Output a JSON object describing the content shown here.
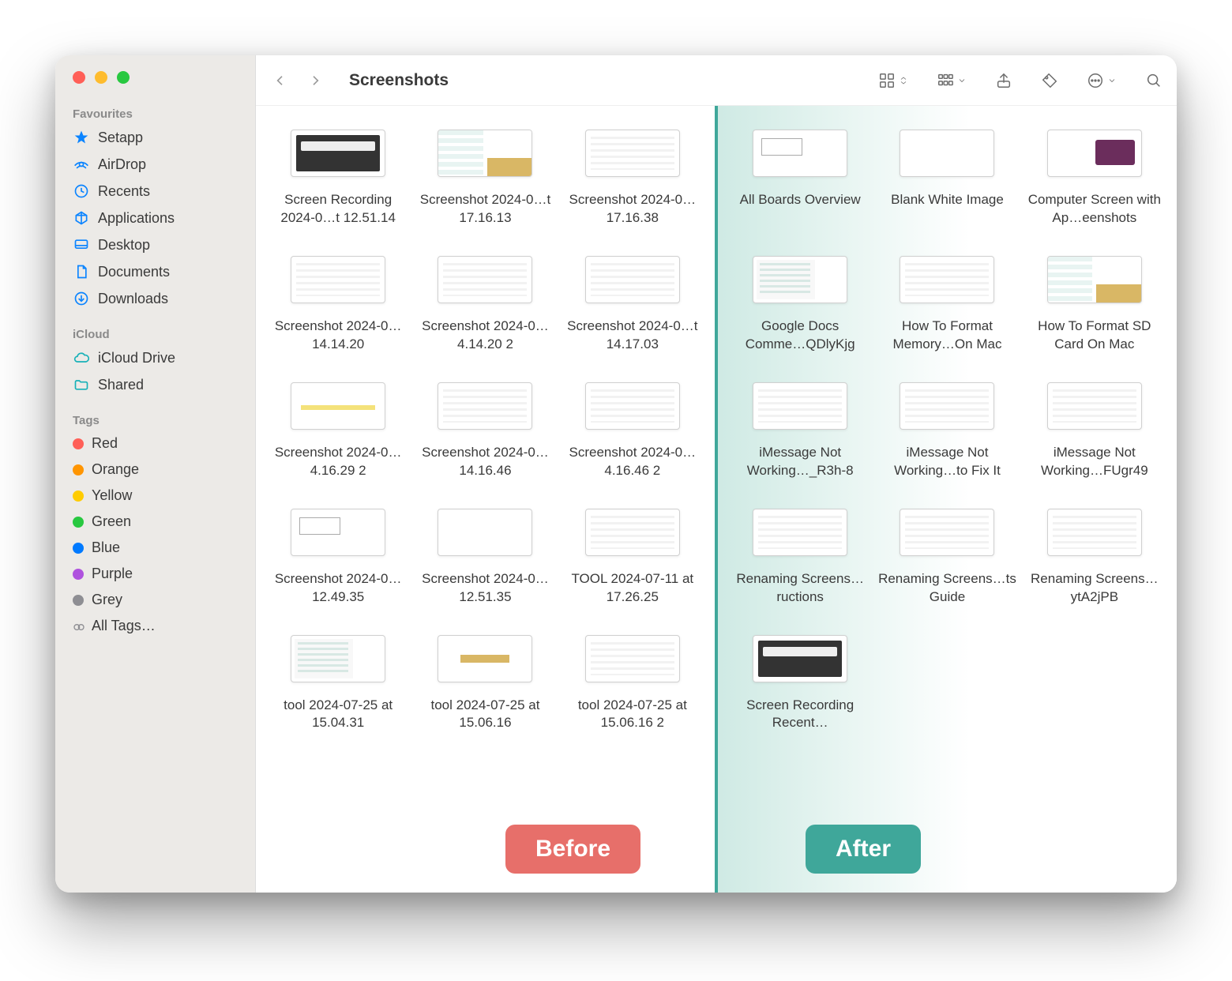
{
  "window": {
    "title": "Screenshots"
  },
  "badges": {
    "before": "Before",
    "after": "After"
  },
  "sidebar": {
    "sections": {
      "favourites": {
        "header": "Favourites",
        "items": [
          {
            "label": "Setapp",
            "icon": "setapp-icon"
          },
          {
            "label": "AirDrop",
            "icon": "airdrop-icon"
          },
          {
            "label": "Recents",
            "icon": "recents-icon"
          },
          {
            "label": "Applications",
            "icon": "applications-icon"
          },
          {
            "label": "Desktop",
            "icon": "desktop-icon"
          },
          {
            "label": "Documents",
            "icon": "documents-icon"
          },
          {
            "label": "Downloads",
            "icon": "downloads-icon"
          }
        ]
      },
      "icloud": {
        "header": "iCloud",
        "items": [
          {
            "label": "iCloud Drive",
            "icon": "icloud-icon"
          },
          {
            "label": "Shared",
            "icon": "shared-folder-icon"
          }
        ]
      },
      "tags": {
        "header": "Tags",
        "items": [
          {
            "label": "Red",
            "color": "#ff5f57"
          },
          {
            "label": "Orange",
            "color": "#ff9500"
          },
          {
            "label": "Yellow",
            "color": "#ffcc00"
          },
          {
            "label": "Green",
            "color": "#28c840"
          },
          {
            "label": "Blue",
            "color": "#007aff"
          },
          {
            "label": "Purple",
            "color": "#af52de"
          },
          {
            "label": "Grey",
            "color": "#8e8e93"
          },
          {
            "label": "All Tags…",
            "color": null
          }
        ]
      }
    }
  },
  "files_before": [
    {
      "name": "Screen Recording 2024-0…t 12.51.14",
      "thumb": "dark"
    },
    {
      "name": "Screenshot 2024-0…t 17.16.13",
      "thumb": "split"
    },
    {
      "name": "Screenshot 2024-0…17.16.38",
      "thumb": "text"
    },
    {
      "name": "Screenshot 2024-0…14.14.20",
      "thumb": "text"
    },
    {
      "name": "Screenshot 2024-0…4.14.20 2",
      "thumb": "text"
    },
    {
      "name": "Screenshot 2024-0…t 14.17.03",
      "thumb": "text"
    },
    {
      "name": "Screenshot 2024-0…4.16.29 2",
      "thumb": "highlight"
    },
    {
      "name": "Screenshot 2024-0…14.16.46",
      "thumb": "text"
    },
    {
      "name": "Screenshot 2024-0…4.16.46 2",
      "thumb": "text"
    },
    {
      "name": "Screenshot 2024-0…12.49.35",
      "thumb": "hello"
    },
    {
      "name": "Screenshot 2024-0…12.51.35",
      "thumb": "blank"
    },
    {
      "name": "TOOL 2024-07-11 at 17.26.25",
      "thumb": "text"
    },
    {
      "name": "tool 2024-07-25 at 15.04.31",
      "thumb": "doc"
    },
    {
      "name": "tool 2024-07-25 at 15.06.16",
      "thumb": "mini"
    },
    {
      "name": "tool 2024-07-25 at 15.06.16 2",
      "thumb": "text"
    }
  ],
  "files_after": [
    {
      "name": "All Boards Overview",
      "thumb": "hello"
    },
    {
      "name": "Blank White Image",
      "thumb": "blank"
    },
    {
      "name": "Computer Screen with Ap…eenshots",
      "thumb": "purple"
    },
    {
      "name": "Google Docs Comme…QDlyKjg",
      "thumb": "doc"
    },
    {
      "name": "How To Format Memory…On Mac",
      "thumb": "text"
    },
    {
      "name": "How To Format SD Card On Mac",
      "thumb": "split"
    },
    {
      "name": "iMessage Not Working…_R3h-8",
      "thumb": "text"
    },
    {
      "name": "iMessage Not Working…to Fix It",
      "thumb": "text"
    },
    {
      "name": "iMessage Not Working…FUgr49",
      "thumb": "text"
    },
    {
      "name": "Renaming Screens…ructions",
      "thumb": "text"
    },
    {
      "name": "Renaming Screens…ts Guide",
      "thumb": "text"
    },
    {
      "name": "Renaming Screens…ytA2jPB",
      "thumb": "text"
    },
    {
      "name": "Screen Recording Recent…",
      "thumb": "dark"
    }
  ]
}
